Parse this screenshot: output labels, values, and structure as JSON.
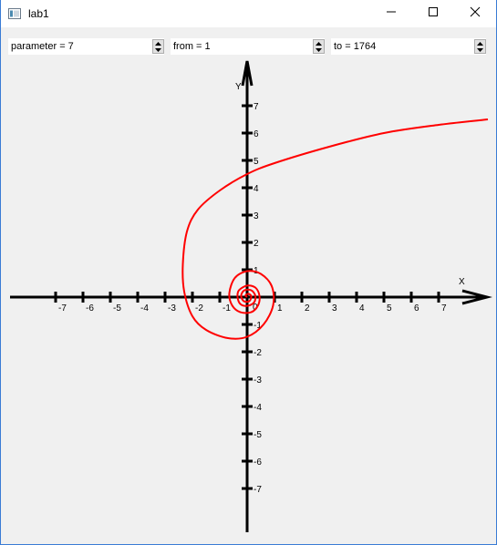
{
  "window": {
    "title": "lab1"
  },
  "controls": {
    "parameter_text": "parameter = 7",
    "from_text": "from = 1",
    "to_text": "to = 1764"
  },
  "colors": {
    "curve": "#ff0000",
    "axes": "#000000",
    "background": "#f0f0f0"
  },
  "icons": {
    "app": "window-app-icon",
    "minimize": "minimize-icon",
    "maximize": "maximize-icon",
    "close": "close-icon",
    "spin_up": "triangle-up-icon",
    "spin_down": "triangle-down-icon"
  },
  "chart_data": {
    "type": "line",
    "title": "",
    "xlabel": "X",
    "ylabel": "Y",
    "xlim": [
      -8.7,
      8.7
    ],
    "ylim": [
      -8.5,
      8.5
    ],
    "grid": false,
    "x_ticks": [
      "-7",
      "-6",
      "-5",
      "-4",
      "-3",
      "-2",
      "-1",
      "1",
      "2",
      "3",
      "4",
      "5",
      "6",
      "7"
    ],
    "y_ticks": [
      "7",
      "6",
      "5",
      "4",
      "3",
      "2",
      "1",
      "-1",
      "-2",
      "-3",
      "-4",
      "-5",
      "-6",
      "-7"
    ],
    "origin_label": "0",
    "series": [
      {
        "points": [
          [
            8.8,
            6.5
          ],
          [
            7,
            6.3
          ],
          [
            5,
            6.0
          ],
          [
            3,
            5.5
          ],
          [
            1,
            4.9
          ],
          [
            0,
            4.5
          ],
          [
            -1,
            3.9
          ],
          [
            -1.8,
            3.2
          ],
          [
            -2.2,
            2.4
          ],
          [
            -2.35,
            1.2
          ],
          [
            -2.3,
            0.2
          ],
          [
            -2.0,
            -0.7
          ],
          [
            -1.5,
            -1.2
          ],
          [
            -0.7,
            -1.5
          ],
          [
            0,
            -1.45
          ],
          [
            0.6,
            -1.0
          ],
          [
            0.95,
            -0.3
          ],
          [
            0.9,
            0.4
          ],
          [
            0.5,
            0.85
          ],
          [
            0,
            0.95
          ],
          [
            -0.45,
            0.7
          ],
          [
            -0.65,
            0.15
          ],
          [
            -0.55,
            -0.3
          ],
          [
            -0.25,
            -0.55
          ],
          [
            0.15,
            -0.55
          ],
          [
            0.4,
            -0.3
          ],
          [
            0.45,
            0.05
          ],
          [
            0.3,
            0.35
          ],
          [
            0,
            0.42
          ],
          [
            -0.3,
            0.25
          ],
          [
            -0.35,
            0
          ],
          [
            -0.25,
            -0.25
          ],
          [
            0,
            -0.32
          ],
          [
            0.25,
            -0.2
          ],
          [
            0.3,
            0.05
          ],
          [
            0.15,
            0.25
          ],
          [
            -0.1,
            0.25
          ],
          [
            -0.22,
            0.05
          ],
          [
            -0.12,
            -0.15
          ],
          [
            0.08,
            -0.15
          ],
          [
            0.15,
            0.03
          ],
          [
            0.05,
            0.12
          ],
          [
            -0.06,
            0.06
          ],
          [
            0,
            0
          ]
        ]
      }
    ]
  }
}
